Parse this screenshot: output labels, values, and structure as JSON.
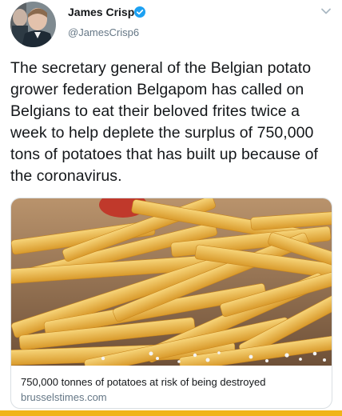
{
  "tweet": {
    "author_name": "James Crisp",
    "handle": "@JamesCrisp6",
    "verified_icon": "verified-badge-icon",
    "menu_icon": "chevron-down-icon",
    "text": "The secretary general of the Belgian potato grower federation Belgapom has called on Belgians to eat their beloved frites twice a week to help deplete the surplus of 750,000 tons of potatoes that has built up because of the coronavirus."
  },
  "card": {
    "image": "french-fries-photo",
    "title": "750,000 tonnes of potatoes at risk of being destroyed",
    "domain": "brusselstimes.com"
  },
  "colors": {
    "verified": "#1da1f2",
    "secondary_text": "#657786",
    "bottom_strip": "#f0b418"
  }
}
